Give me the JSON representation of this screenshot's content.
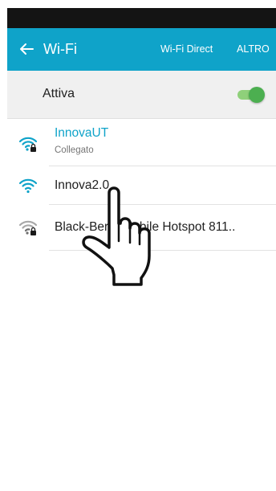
{
  "app_bar": {
    "title": "Wi-Fi",
    "wifi_direct_label": "Wi-Fi Direct",
    "more_label": "ALTRO",
    "color": "#0fa3c9"
  },
  "wifi_toggle": {
    "label": "Attiva",
    "state": "on",
    "accent": "#4caf50"
  },
  "networks": [
    {
      "name": "InnovaUT",
      "status": "Collegato",
      "secured": true,
      "name_color": "#0fa3c9",
      "icon": "wifi-lock-icon"
    },
    {
      "name": "Innova2.0",
      "status": "",
      "secured": false,
      "name_color": "#212121",
      "icon": "wifi-icon"
    },
    {
      "name": "Black-Berry Mobile Hotspot 811..",
      "status": "",
      "secured": true,
      "name_color": "#212121",
      "icon": "wifi-lock-icon"
    }
  ],
  "overlay": {
    "icon": "pointing-hand-icon"
  }
}
